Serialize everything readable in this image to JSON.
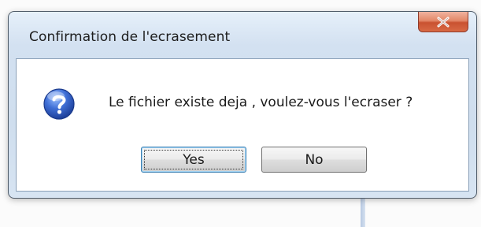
{
  "dialog": {
    "title": "Confirmation de l'ecrasement",
    "message": "Le fichier existe deja , voulez-vous l'ecraser ?",
    "icon": "question-icon",
    "close_icon": "close-icon",
    "buttons": {
      "yes_label": "Yes",
      "no_label": "No"
    }
  },
  "colors": {
    "title_bar": "#d3e1f1",
    "close_button": "#c95231",
    "question_icon": "#2f5fbf",
    "default_button_border": "#3c7fb1"
  }
}
